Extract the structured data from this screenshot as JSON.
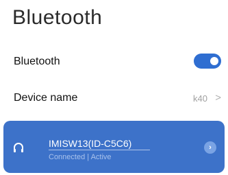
{
  "page": {
    "title": "Bluetooth"
  },
  "bluetooth_toggle": {
    "label": "Bluetooth",
    "enabled": true,
    "accent_color": "#2f6ed1"
  },
  "device_name_row": {
    "label": "Device name",
    "value": "k40",
    "chevron": ">"
  },
  "connected_device": {
    "name": "IMISW13(ID-C5C6)",
    "status": "Connected  | Active",
    "icon": "headphones-icon",
    "card_color": "#3d72c9",
    "chevron": "›"
  }
}
